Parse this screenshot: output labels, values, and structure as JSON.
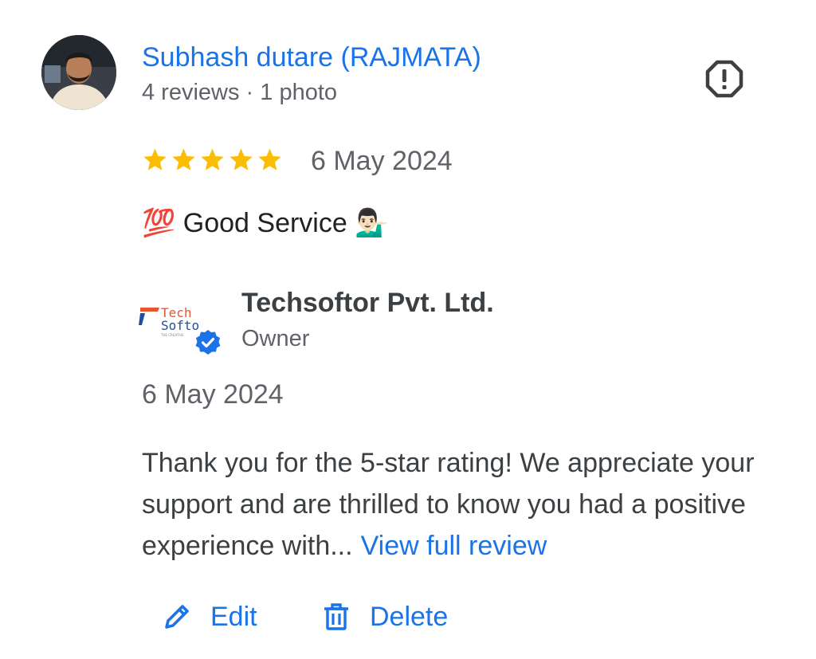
{
  "reviewer": {
    "name": "Subhash dutare (RAJMATA)",
    "meta": "4 reviews · 1 photo",
    "avatar_icon": "user-photo"
  },
  "review": {
    "rating": 5,
    "rating_max": 5,
    "date": "6 May 2024",
    "text": "💯 Good Service 💁🏻‍♂️"
  },
  "owner_reply": {
    "owner_name": "Techsoftor Pvt. Ltd.",
    "role": "Owner",
    "logo_text_line1": "Tech",
    "logo_text_line2": "Softo",
    "logo_tagline": "THE CREATIVE",
    "date": "6 May 2024",
    "text": "Thank you for the 5-star rating! We appreciate your support and are thrilled to know you had a positive experience with...",
    "view_full_label": "View full review"
  },
  "actions": {
    "edit_label": "Edit",
    "delete_label": "Delete"
  },
  "icons": {
    "report": "report-icon",
    "star": "star-icon",
    "verified": "verified-badge-icon",
    "edit": "pencil-icon",
    "delete": "trash-icon"
  },
  "colors": {
    "link_blue": "#1a73e8",
    "star_gold": "#fbbc04",
    "text_primary": "#202124",
    "text_secondary": "#5f6368",
    "verified_blue": "#1a73e8"
  }
}
